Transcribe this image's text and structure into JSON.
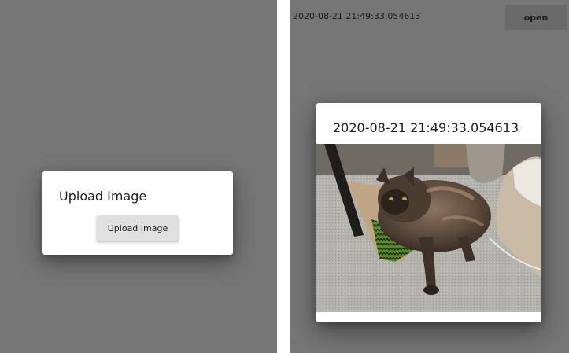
{
  "left_screen": {
    "dialog": {
      "title": "Upload Image",
      "button_label": "Upload Image"
    }
  },
  "right_screen": {
    "header": {
      "timestamp": "2020-08-21 21:49:33.054613",
      "open_button_label": "open"
    },
    "dialog": {
      "title": "2020-08-21 21:49:33.054613",
      "image": "cat-photo"
    }
  },
  "colors": {
    "backdrop": "#767676",
    "dialog_bg": "#ffffff",
    "button_bg": "#e0e0e0",
    "open_button_bg": "#6a6a6a"
  }
}
